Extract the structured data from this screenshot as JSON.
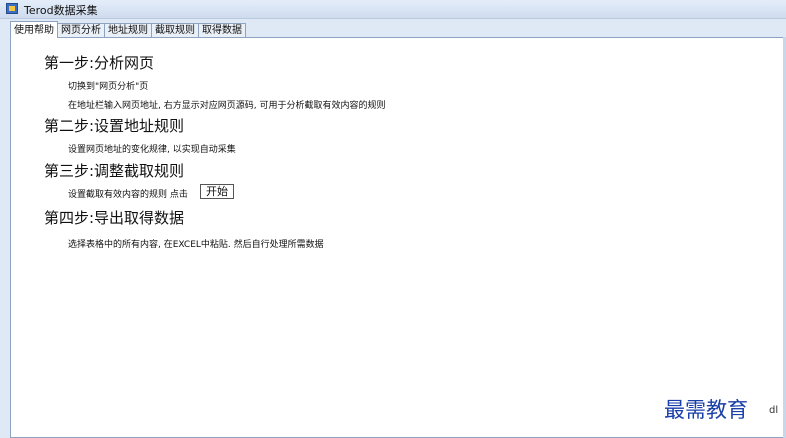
{
  "window": {
    "title": "Terod数据采集",
    "icon": "app-icon"
  },
  "tabs": [
    {
      "label": "使用帮助",
      "active": true
    },
    {
      "label": "网页分析",
      "active": false
    },
    {
      "label": "地址规则",
      "active": false
    },
    {
      "label": "截取规则",
      "active": false
    },
    {
      "label": "取得数据",
      "active": false
    }
  ],
  "help": {
    "step1": {
      "title": "第一步:分析网页",
      "line1": "切换到\"网页分析\"页",
      "line2": "在地址栏输入网页地址, 右方显示对应网页源码, 可用于分析截取有效内容的规则"
    },
    "step2": {
      "title": "第二步:设置地址规则",
      "line1": "设置网页地址的变化规律, 以实现自动采集"
    },
    "step3": {
      "title": "第三步:调整截取规则",
      "line1": "设置截取有效内容的规则  点击",
      "button": "开始"
    },
    "step4": {
      "title": "第四步:导出取得数据",
      "line1": "选择表格中的所有内容, 在EXCEL中粘贴. 然后自行处理所需数据"
    }
  },
  "watermark": {
    "text": "最需教育",
    "tail": "dl"
  }
}
